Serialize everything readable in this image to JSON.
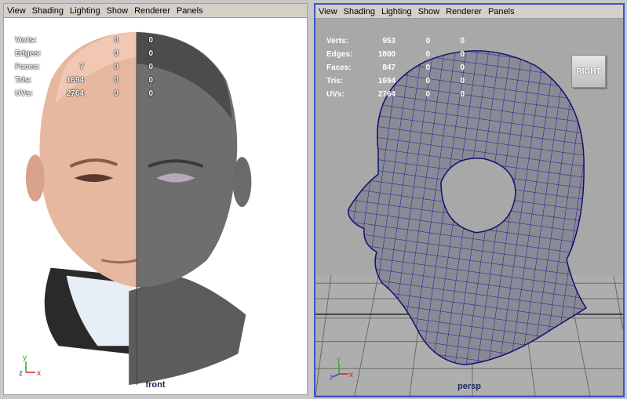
{
  "menu": [
    "View",
    "Shading",
    "Lighting",
    "Show",
    "Renderer",
    "Panels"
  ],
  "front": {
    "camera": "front",
    "hud": [
      {
        "label": "Verts:",
        "v1": "",
        "v2": "0",
        "v3": "0"
      },
      {
        "label": "Edges:",
        "v1": "",
        "v2": "0",
        "v3": "0"
      },
      {
        "label": "Faces:",
        "v1": "7",
        "v2": "0",
        "v3": "0"
      },
      {
        "label": "Tris:",
        "v1": "1694",
        "v2": "0",
        "v3": "0"
      },
      {
        "label": "UVs:",
        "v1": "2764",
        "v2": "0",
        "v3": "0"
      }
    ],
    "axis": {
      "y": "y",
      "z": "z",
      "x": "x"
    }
  },
  "persp": {
    "camera": "persp",
    "hud": [
      {
        "label": "Verts:",
        "v1": "953",
        "v2": "0",
        "v3": "0"
      },
      {
        "label": "Edges:",
        "v1": "1800",
        "v2": "0",
        "v3": "0"
      },
      {
        "label": "Faces:",
        "v1": "847",
        "v2": "0",
        "v3": "0"
      },
      {
        "label": "Tris:",
        "v1": "1694",
        "v2": "0",
        "v3": "0"
      },
      {
        "label": "UVs:",
        "v1": "2764",
        "v2": "0",
        "v3": "0"
      }
    ],
    "viewcube": "RIGHT",
    "axis": {
      "y": "y",
      "z": "z",
      "x": "x"
    }
  },
  "colors": {
    "menubar": "#d4d0c8",
    "active_border": "#3a56c8",
    "wireframe": "#1a1a8c",
    "mesh_fill": "#8a8a96",
    "grid": "#5e5e5e"
  }
}
